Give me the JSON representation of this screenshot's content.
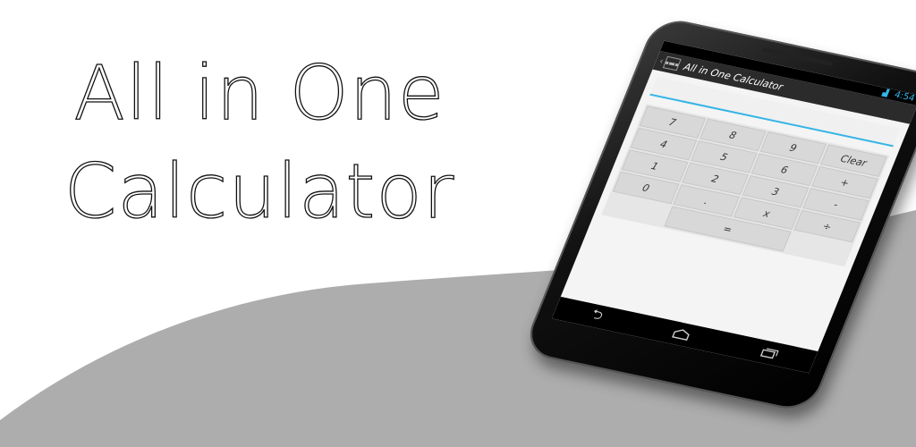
{
  "headline": {
    "line1": "All in One",
    "line2": "Calculator"
  },
  "colors": {
    "accent": "#33b5e5",
    "wave": "#adadad",
    "background": "#ffffff"
  },
  "status_bar": {
    "time": "4:54"
  },
  "action_bar": {
    "title": "All in One Calculator"
  },
  "display": {
    "value": "",
    "placeholder": ""
  },
  "keypad": {
    "keys": [
      "7",
      "8",
      "9",
      "Clear",
      "4",
      "5",
      "6",
      "+",
      "1",
      "2",
      "3",
      "-",
      "0",
      ".",
      "x",
      "÷",
      "="
    ]
  },
  "nav_bar": {
    "icons": [
      "back-icon",
      "home-icon",
      "recents-icon"
    ]
  }
}
